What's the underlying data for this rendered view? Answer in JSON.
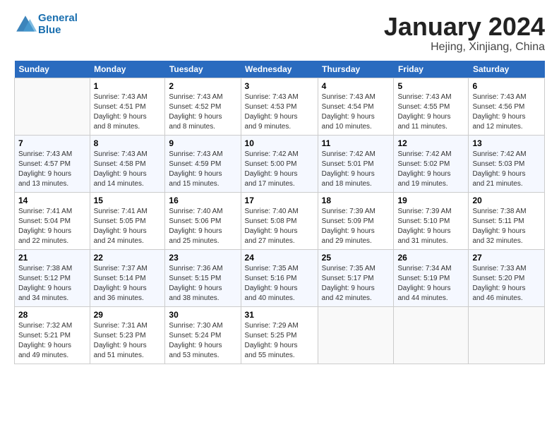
{
  "logo": {
    "line1": "General",
    "line2": "Blue"
  },
  "title": "January 2024",
  "location": "Hejing, Xinjiang, China",
  "days_of_week": [
    "Sunday",
    "Monday",
    "Tuesday",
    "Wednesday",
    "Thursday",
    "Friday",
    "Saturday"
  ],
  "weeks": [
    [
      {
        "day": "",
        "info": ""
      },
      {
        "day": "1",
        "info": "Sunrise: 7:43 AM\nSunset: 4:51 PM\nDaylight: 9 hours\nand 8 minutes."
      },
      {
        "day": "2",
        "info": "Sunrise: 7:43 AM\nSunset: 4:52 PM\nDaylight: 9 hours\nand 8 minutes."
      },
      {
        "day": "3",
        "info": "Sunrise: 7:43 AM\nSunset: 4:53 PM\nDaylight: 9 hours\nand 9 minutes."
      },
      {
        "day": "4",
        "info": "Sunrise: 7:43 AM\nSunset: 4:54 PM\nDaylight: 9 hours\nand 10 minutes."
      },
      {
        "day": "5",
        "info": "Sunrise: 7:43 AM\nSunset: 4:55 PM\nDaylight: 9 hours\nand 11 minutes."
      },
      {
        "day": "6",
        "info": "Sunrise: 7:43 AM\nSunset: 4:56 PM\nDaylight: 9 hours\nand 12 minutes."
      }
    ],
    [
      {
        "day": "7",
        "info": "Sunrise: 7:43 AM\nSunset: 4:57 PM\nDaylight: 9 hours\nand 13 minutes."
      },
      {
        "day": "8",
        "info": "Sunrise: 7:43 AM\nSunset: 4:58 PM\nDaylight: 9 hours\nand 14 minutes."
      },
      {
        "day": "9",
        "info": "Sunrise: 7:43 AM\nSunset: 4:59 PM\nDaylight: 9 hours\nand 15 minutes."
      },
      {
        "day": "10",
        "info": "Sunrise: 7:42 AM\nSunset: 5:00 PM\nDaylight: 9 hours\nand 17 minutes."
      },
      {
        "day": "11",
        "info": "Sunrise: 7:42 AM\nSunset: 5:01 PM\nDaylight: 9 hours\nand 18 minutes."
      },
      {
        "day": "12",
        "info": "Sunrise: 7:42 AM\nSunset: 5:02 PM\nDaylight: 9 hours\nand 19 minutes."
      },
      {
        "day": "13",
        "info": "Sunrise: 7:42 AM\nSunset: 5:03 PM\nDaylight: 9 hours\nand 21 minutes."
      }
    ],
    [
      {
        "day": "14",
        "info": "Sunrise: 7:41 AM\nSunset: 5:04 PM\nDaylight: 9 hours\nand 22 minutes."
      },
      {
        "day": "15",
        "info": "Sunrise: 7:41 AM\nSunset: 5:05 PM\nDaylight: 9 hours\nand 24 minutes."
      },
      {
        "day": "16",
        "info": "Sunrise: 7:40 AM\nSunset: 5:06 PM\nDaylight: 9 hours\nand 25 minutes."
      },
      {
        "day": "17",
        "info": "Sunrise: 7:40 AM\nSunset: 5:08 PM\nDaylight: 9 hours\nand 27 minutes."
      },
      {
        "day": "18",
        "info": "Sunrise: 7:39 AM\nSunset: 5:09 PM\nDaylight: 9 hours\nand 29 minutes."
      },
      {
        "day": "19",
        "info": "Sunrise: 7:39 AM\nSunset: 5:10 PM\nDaylight: 9 hours\nand 31 minutes."
      },
      {
        "day": "20",
        "info": "Sunrise: 7:38 AM\nSunset: 5:11 PM\nDaylight: 9 hours\nand 32 minutes."
      }
    ],
    [
      {
        "day": "21",
        "info": "Sunrise: 7:38 AM\nSunset: 5:12 PM\nDaylight: 9 hours\nand 34 minutes."
      },
      {
        "day": "22",
        "info": "Sunrise: 7:37 AM\nSunset: 5:14 PM\nDaylight: 9 hours\nand 36 minutes."
      },
      {
        "day": "23",
        "info": "Sunrise: 7:36 AM\nSunset: 5:15 PM\nDaylight: 9 hours\nand 38 minutes."
      },
      {
        "day": "24",
        "info": "Sunrise: 7:35 AM\nSunset: 5:16 PM\nDaylight: 9 hours\nand 40 minutes."
      },
      {
        "day": "25",
        "info": "Sunrise: 7:35 AM\nSunset: 5:17 PM\nDaylight: 9 hours\nand 42 minutes."
      },
      {
        "day": "26",
        "info": "Sunrise: 7:34 AM\nSunset: 5:19 PM\nDaylight: 9 hours\nand 44 minutes."
      },
      {
        "day": "27",
        "info": "Sunrise: 7:33 AM\nSunset: 5:20 PM\nDaylight: 9 hours\nand 46 minutes."
      }
    ],
    [
      {
        "day": "28",
        "info": "Sunrise: 7:32 AM\nSunset: 5:21 PM\nDaylight: 9 hours\nand 49 minutes."
      },
      {
        "day": "29",
        "info": "Sunrise: 7:31 AM\nSunset: 5:23 PM\nDaylight: 9 hours\nand 51 minutes."
      },
      {
        "day": "30",
        "info": "Sunrise: 7:30 AM\nSunset: 5:24 PM\nDaylight: 9 hours\nand 53 minutes."
      },
      {
        "day": "31",
        "info": "Sunrise: 7:29 AM\nSunset: 5:25 PM\nDaylight: 9 hours\nand 55 minutes."
      },
      {
        "day": "",
        "info": ""
      },
      {
        "day": "",
        "info": ""
      },
      {
        "day": "",
        "info": ""
      }
    ]
  ]
}
